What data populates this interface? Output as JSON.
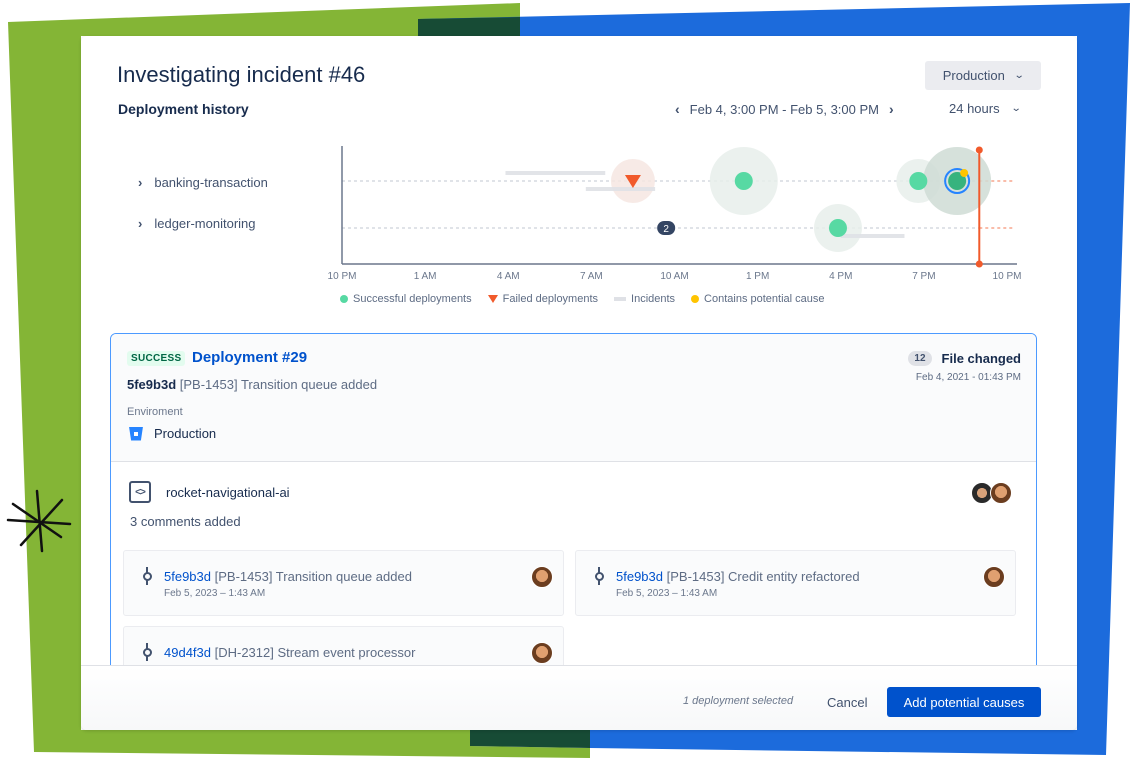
{
  "decor": {
    "green": "#84b536",
    "blue": "#1c6bdc",
    "dark": "#174b35",
    "star": "#111111"
  },
  "header": {
    "title": "Investigating incident #46",
    "subtitle": "Deployment history",
    "environment_select": {
      "value": "Production",
      "icon": "chevron-down-icon"
    },
    "date_range": {
      "label": "Feb 4, 3:00 PM - Feb 5, 3:00 PM",
      "prev_icon": "chevron-left-icon",
      "next_icon": "chevron-right-icon"
    },
    "period_select": {
      "value": "24 hours",
      "icon": "chevron-down-icon"
    }
  },
  "services": [
    {
      "name": "banking-transaction",
      "icon": "chevron-right-icon"
    },
    {
      "name": "ledger-monitoring",
      "icon": "chevron-right-icon"
    }
  ],
  "chart_data": {
    "type": "scatter",
    "title": "Deployment history",
    "x_unit": "hours since 10 PM (Feb 4)",
    "xlim": [
      0,
      24
    ],
    "x_ticks": [
      {
        "value": 0,
        "label": "10 PM"
      },
      {
        "value": 3,
        "label": "1 AM"
      },
      {
        "value": 6,
        "label": "4 AM"
      },
      {
        "value": 9,
        "label": "7 AM"
      },
      {
        "value": 12,
        "label": "10 AM"
      },
      {
        "value": 15,
        "label": "1 PM"
      },
      {
        "value": 18,
        "label": "4 PM"
      },
      {
        "value": 21,
        "label": "7 PM"
      },
      {
        "value": 24,
        "label": "10 PM"
      }
    ],
    "categories": [
      "banking-transaction",
      "ledger-monitoring"
    ],
    "grid": "dashed horizontal per row",
    "deployments": [
      {
        "row": 0,
        "x": 10.5,
        "status": "failed"
      },
      {
        "row": 0,
        "x": 14.5,
        "status": "success"
      },
      {
        "row": 0,
        "x": 20.8,
        "status": "success"
      },
      {
        "row": 0,
        "x": 22.2,
        "status": "success",
        "selected": true,
        "potential_cause": true
      },
      {
        "row": 1,
        "x": 17.9,
        "status": "success"
      },
      {
        "row": 1,
        "x": 11.7,
        "status": "cluster",
        "count": 2
      }
    ],
    "incidents": [
      {
        "row": 0,
        "start": 5.9,
        "end": 9.5
      },
      {
        "row": 0,
        "start": 8.8,
        "end": 11.3
      },
      {
        "row": 1,
        "start": 18.0,
        "end": 20.3
      }
    ],
    "current_time_marker": 23.0,
    "legend": [
      {
        "label": "Successful deployments",
        "color": "#57d9a3",
        "shape": "dot"
      },
      {
        "label": "Failed deployments",
        "color": "#f15a2b",
        "shape": "triangle"
      },
      {
        "label": "Incidents",
        "color": "#dfe1e6",
        "shape": "bar"
      },
      {
        "label": "Contains potential cause",
        "color": "#ffc400",
        "shape": "dot"
      }
    ],
    "legend_position": "bottom"
  },
  "detail": {
    "status_badge": "SUCCESS",
    "title": "Deployment #29",
    "commit_hash": "5fe9b3d",
    "commit_message": "[PB-1453] Transition queue added",
    "env_label": "Enviroment",
    "env_value": "Production",
    "files_count": "12",
    "files_label": "File changed",
    "files_date": "Feb 4, 2021 - 01:43 PM",
    "repo_name": "rocket-navigational-ai",
    "comments": "3 comments added",
    "commits": [
      {
        "hash": "5fe9b3d",
        "message": " [PB-1453] Transition queue added",
        "date": "Feb 5, 2023 – 1:43 AM"
      },
      {
        "hash": "5fe9b3d",
        "message": " [PB-1453] Credit entity refactored",
        "date": "Feb 5, 2023 – 1:43 AM"
      },
      {
        "hash": "49d4f3d",
        "message": " [DH-2312] Stream event processor",
        "date": ""
      }
    ]
  },
  "footer": {
    "selection_text": "1 deployment selected",
    "cancel_label": "Cancel",
    "primary_label": "Add potential causes"
  }
}
